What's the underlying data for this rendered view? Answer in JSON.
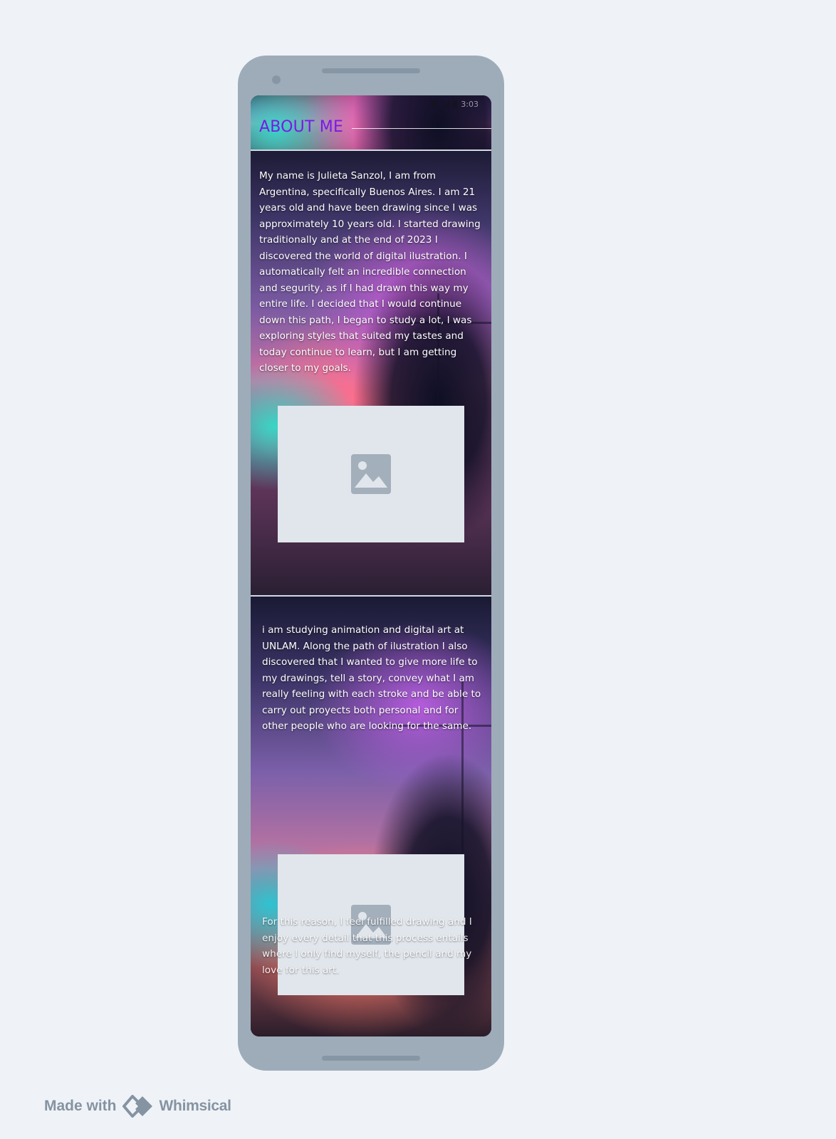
{
  "status_bar": {
    "time": "3:03"
  },
  "header": {
    "title": "ABOUT ME",
    "title_color": "#7b18e6"
  },
  "content": {
    "paragraph_1": "My name is Julieta Sanzol, I am from Argentina, specifically Buenos Aires. I am 21 years old and have been drawing since I was approximately 10 years old. I started drawing traditionally and at the end of 2023 I discovered the world of digital ilustration. I automatically felt an incredible connection and segurity, as if I had drawn this way my entire life. I decided that I would continue down this path, I began to study a lot, I was exploring styles that suited my tastes and today continue to learn, but I am getting closer to my goals.",
    "paragraph_2": "i am studying animation and digital art at UNLAM. Along the path of ilustration I also discovered that I wanted to give more life to my drawings, tell a story, convey what I am really feeling with each stroke and be able to carry out proyects both personal and for other people who are looking for the same.",
    "paragraph_3": "For this reason, I feel fulfilled drawing and I enjoy every detail that this process entails where I only find myself, the pencil and my love for this art."
  },
  "icons": {
    "image_placeholder": "image-icon",
    "wifi": "wifi-icon",
    "signal": "signal-icon",
    "battery": "battery-icon",
    "brand_logo": "whimsical-logo-icon"
  },
  "footer": {
    "made_with": "Made with",
    "brand": "Whimsical"
  },
  "colors": {
    "page_background": "#eff3f7",
    "device_frame": "#9eacb9",
    "placeholder_fill": "#e1e6ec",
    "placeholder_icon": "#a3afbb",
    "badge_text": "#8593a2"
  }
}
